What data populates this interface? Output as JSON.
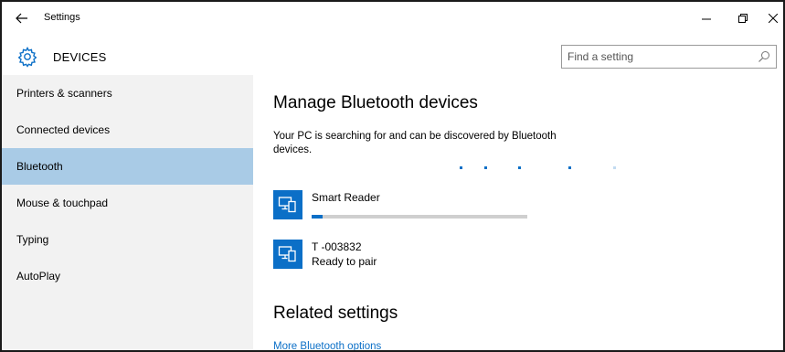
{
  "window": {
    "title": "Settings"
  },
  "header": {
    "section_title": "DEVICES",
    "search_placeholder": "Find a setting"
  },
  "sidebar": {
    "items": [
      {
        "label": "Printers & scanners"
      },
      {
        "label": "Connected devices"
      },
      {
        "label": "Bluetooth",
        "selected": true
      },
      {
        "label": "Mouse & touchpad"
      },
      {
        "label": "Typing"
      },
      {
        "label": "AutoPlay"
      }
    ]
  },
  "main": {
    "heading": "Manage Bluetooth devices",
    "status_text": "Your PC is searching for and can be discovered by Bluetooth devices.",
    "devices": [
      {
        "name": "Smart Reader",
        "status": "",
        "pairing_progress": 0.05
      },
      {
        "name": "T -003832",
        "status": "Ready to pair"
      }
    ],
    "related_heading": "Related settings",
    "related_link": "More Bluetooth options"
  },
  "colors": {
    "accent": "#0b6fc7",
    "selected_nav": "#a9cbe6",
    "sidebar_bg": "#f2f2f2"
  },
  "icons": {
    "back": "arrow-left-icon",
    "section": "gear-icon",
    "search": "search-icon",
    "device": "bluetooth-device-icon"
  }
}
